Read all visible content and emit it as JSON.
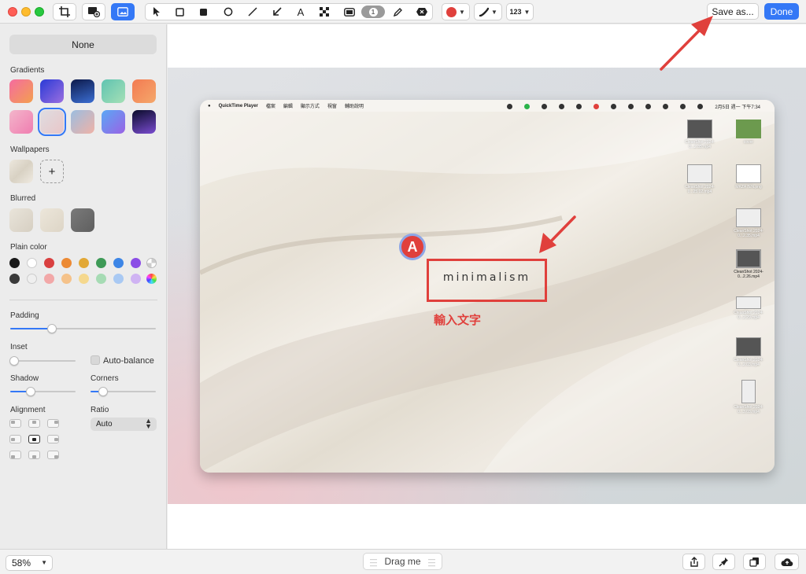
{
  "toolbar": {
    "icons": [
      "crop-icon",
      "background-image-icon",
      "background-tool-icon",
      "arrow-cursor-icon",
      "rectangle-icon",
      "filled-rectangle-icon",
      "ellipse-icon",
      "line-icon",
      "arrow-icon",
      "text-icon",
      "pixelate-icon",
      "highlight-icon",
      "counter-icon",
      "pencil-icon",
      "blur-icon"
    ],
    "counter_label": "1",
    "text_tool_label": "A",
    "color_accent": "#e0403c",
    "font_size_label": "123",
    "save_label": "Save as...",
    "done_label": "Done"
  },
  "sidebar": {
    "none_label": "None",
    "gradients_label": "Gradients",
    "wallpapers_label": "Wallpapers",
    "add_wallpaper_label": "+",
    "blurred_label": "Blurred",
    "plain_color_label": "Plain color",
    "padding_label": "Padding",
    "inset_label": "Inset",
    "auto_balance_label": "Auto-balance",
    "shadow_label": "Shadow",
    "corners_label": "Corners",
    "alignment_label": "Alignment",
    "ratio_label": "Ratio",
    "ratio_value": "Auto",
    "padding_value": 0.29,
    "inset_value": 0.0,
    "shadow_value": 0.3,
    "corners_value": 0.19,
    "auto_balance_checked": false,
    "selected_gradient": 6,
    "selected_alignment": 4
  },
  "canvas": {
    "menubar": {
      "app": "QuickTime Player",
      "items": [
        "檔案",
        "編輯",
        "顯示方式",
        "視窗",
        "輔助說明"
      ],
      "clock": "2月5日 週一 下午7:34"
    },
    "desktop_icons": [
      "CleanShot 2024-0...2.35.mp4",
      "cover",
      "CleanShot 2024-0...25.02.mp4",
      "MKZA7EN.png",
      "CleanShot 2024-0...2.35.mp4",
      "CleanShot 2024-0...2.26.mp4",
      "CleanShot 2024-0...2.29.mp4",
      "CleanShot 2024-0...2.03.mp4",
      "CleanShot 2024-0...3.03.mp4"
    ],
    "marker_label": "A",
    "boxed_text": "minimalism",
    "note_text": "輸入文字"
  },
  "bottombar": {
    "zoom_label": "58%",
    "drag_label": "Drag me",
    "icons": [
      "share-icon",
      "pin-icon",
      "copy-icon",
      "cloud-upload-icon"
    ]
  }
}
